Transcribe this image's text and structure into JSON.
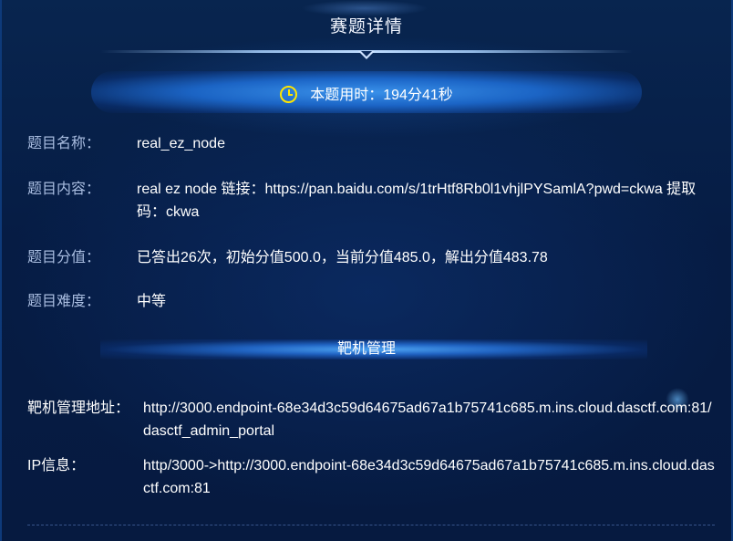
{
  "header": {
    "title": "赛题详情",
    "time_label": "本题用时：194分41秒"
  },
  "details": {
    "name_label": "题目名称：",
    "name_value": "real_ez_node",
    "content_label": "题目内容：",
    "content_value": "real ez node 链接：https://pan.baidu.com/s/1trHtf8Rb0l1vhjlPYSamlA?pwd=ckwa 提取码：ckwa",
    "score_label": "题目分值：",
    "score_value": "已答出26次，初始分值500.0，当前分值485.0，解出分值483.78",
    "difficulty_label": "题目难度：",
    "difficulty_value": "中等"
  },
  "target": {
    "section_title": "靶机管理",
    "address_label": "靶机管理地址：",
    "address_value": "http://3000.endpoint-68e34d3c59d64675ad67a1b75741c685.m.ins.cloud.dasctf.com:81/dasctf_admin_portal",
    "ip_label": "IP信息：",
    "ip_value": "http/3000->http://3000.endpoint-68e34d3c59d64675ad67a1b75741c685.m.ins.cloud.dasctf.com:81"
  },
  "colors": {
    "background": "#072151",
    "label": "#a9bde0",
    "text": "#ffffff",
    "clock_icon": "#ffe600",
    "accent_glow": "#3c96f0"
  },
  "icons": {
    "timer": "clock-icon"
  }
}
